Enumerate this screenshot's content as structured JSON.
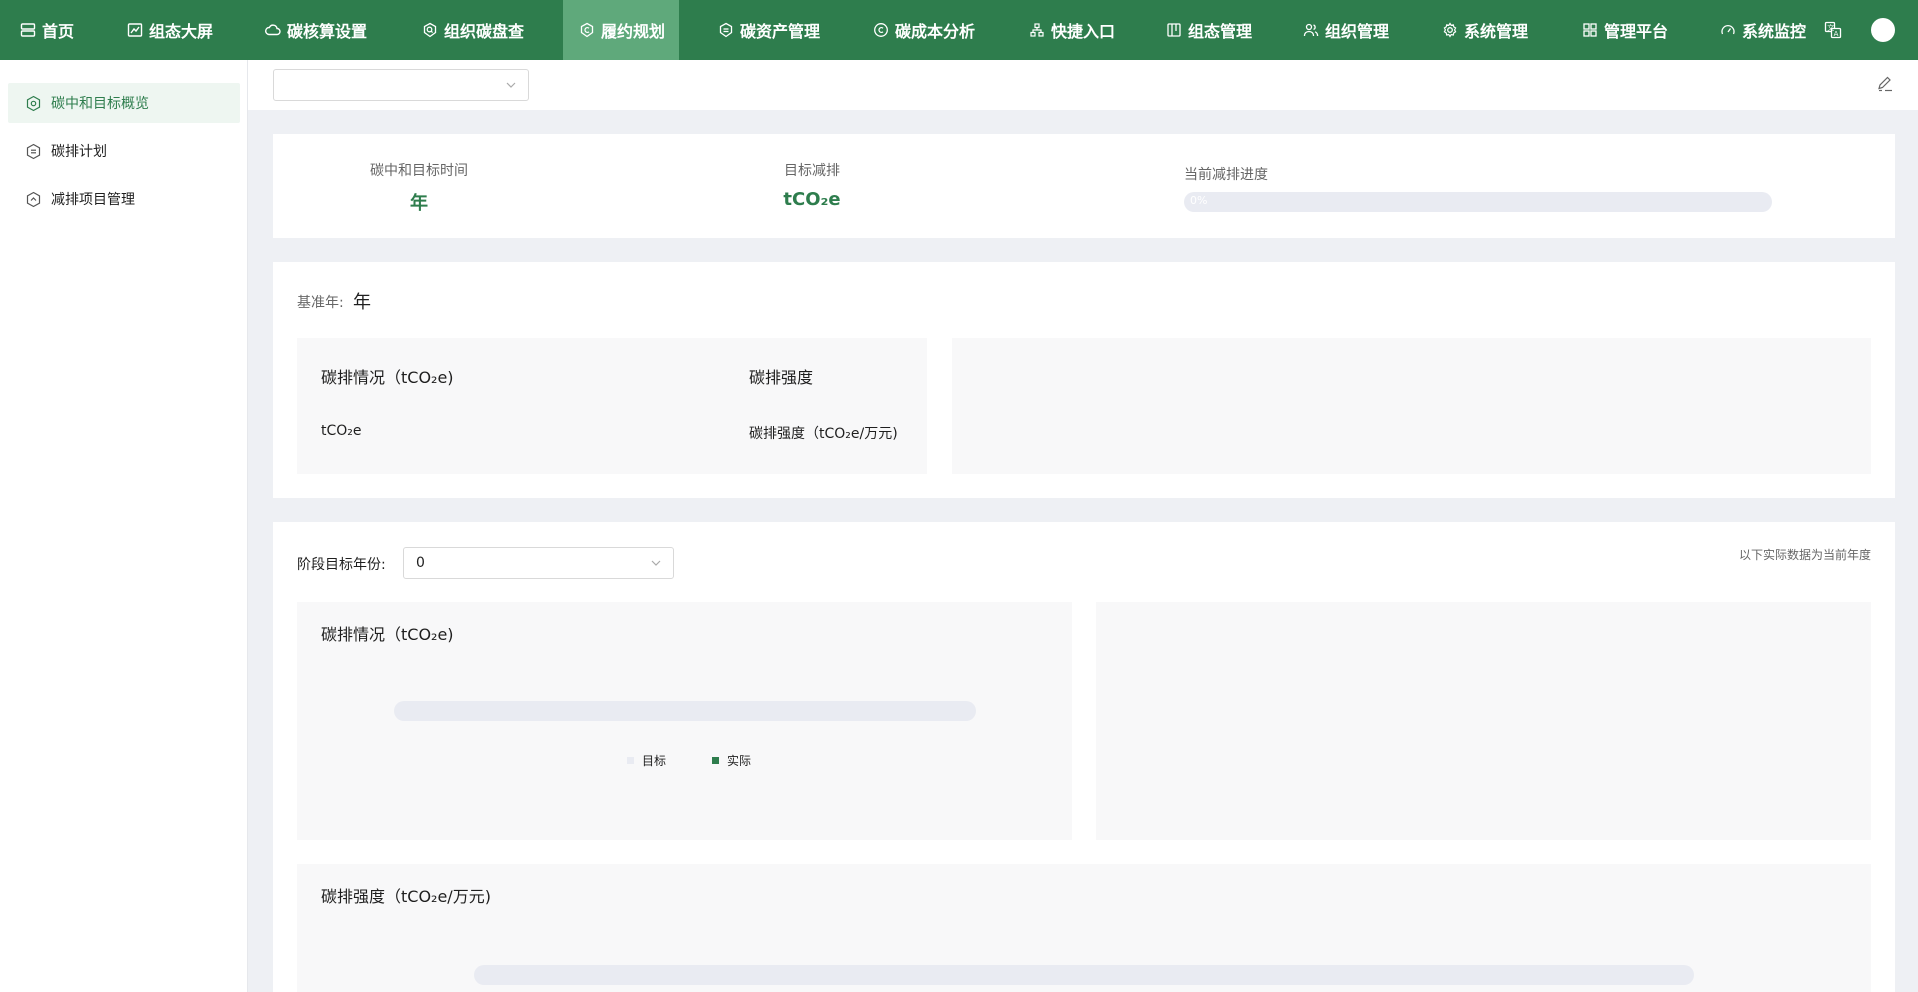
{
  "colors": {
    "brand": "#2e7d4d",
    "brand_active": "#5fa97b",
    "track": "#e9ebf2",
    "panel_bg": "#f8f8f9",
    "legend_target": "#e9ebf2",
    "legend_actual": "#2e7d4d"
  },
  "topnav": {
    "items": [
      {
        "label": "首页",
        "icon": "home-icon"
      },
      {
        "label": "组态大屏",
        "icon": "chart-line-icon"
      },
      {
        "label": "碳核算设置",
        "icon": "cloud-icon"
      },
      {
        "label": "组织碳盘查",
        "icon": "search-shield-icon"
      },
      {
        "label": "履约规划",
        "icon": "carbon-c-icon"
      },
      {
        "label": "碳资产管理",
        "icon": "asset-shield-icon"
      },
      {
        "label": "碳成本分析",
        "icon": "carbon-coin-icon"
      },
      {
        "label": "快捷入口",
        "icon": "sitemap-icon"
      },
      {
        "label": "组态管理",
        "icon": "board-icon"
      },
      {
        "label": "组织管理",
        "icon": "users-icon"
      },
      {
        "label": "系统管理",
        "icon": "gear-icon"
      },
      {
        "label": "管理平台",
        "icon": "grid-icon"
      },
      {
        "label": "系统监控",
        "icon": "gauge-icon"
      }
    ],
    "active_index": 4,
    "tools": [
      "translate-icon",
      "avatar"
    ]
  },
  "sidebar": {
    "items": [
      {
        "label": "碳中和目标概览",
        "icon": "hexagon-icon",
        "active": true
      },
      {
        "label": "碳排计划",
        "icon": "hexagon-icon",
        "active": false
      },
      {
        "label": "减排项目管理",
        "icon": "hexagon-icon",
        "active": false
      }
    ]
  },
  "toolbar": {
    "org_select_value": ""
  },
  "summary": {
    "neutral_time_label": "碳中和目标时间",
    "neutral_time_value": "年",
    "target_reduction_label": "目标减排",
    "target_reduction_value": "tCO₂e",
    "progress_label": "当前减排进度",
    "progress_text": "0%",
    "progress_fraction": 0
  },
  "base": {
    "year_label": "基准年:",
    "year_value": "年",
    "emission_title": "碳排情况（tCO₂e)",
    "emission_value": "tCO₂e",
    "intensity_title": "碳排强度",
    "intensity_value": "碳排强度（tCO₂e/万元)"
  },
  "stage": {
    "year_label": "阶段目标年份:",
    "year_value": "0",
    "note": "以下实际数据为当前年度",
    "emission_title": "碳排情况（tCO₂e)",
    "legend_target": "目标",
    "legend_actual": "实际",
    "intensity_title": "碳排强度（tCO₂e/万元)"
  }
}
